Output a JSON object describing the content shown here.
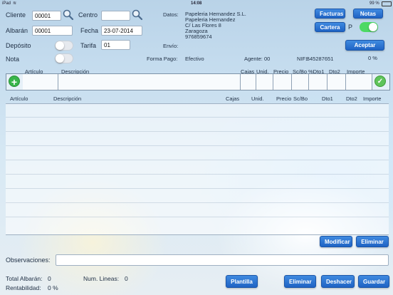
{
  "status_bar": {
    "device": "iPad",
    "time": "14:08",
    "battery": "99 %"
  },
  "header": {
    "cliente_label": "Cliente",
    "cliente_value": "00001",
    "centro_label": "Centro",
    "centro_value": "",
    "albaran_label": "Albarán",
    "albaran_value": "00001",
    "fecha_label": "Fecha",
    "fecha_value": "23-07-2014",
    "deposito_label": "Depósito",
    "tarifa_label": "Tarifa",
    "tarifa_value": "01",
    "nota_label": "Nota",
    "datos_label": "Datos:",
    "datos_lines": [
      "Papeleria Hernandez S.L.",
      "Papeleria Hernandez",
      "C/ Las Flores 8",
      "Zaragoza",
      "976859674"
    ],
    "envio_label": "Envío:",
    "forma_pago_label": "Forma Pago:",
    "forma_pago_value": "Efectivo",
    "agente_label": "Agente:",
    "agente_value": "00",
    "nif_label": "NIF:",
    "nif_value": "B45287651",
    "percent_value": "0 %",
    "facturas_button": "Facturas",
    "notas_button": "Notas",
    "cartera_button": "Cartera",
    "p_label": "P",
    "aceptar_button": "Aceptar"
  },
  "entry_columns": [
    "Artículo",
    "Descripción",
    "Cajas",
    "Unid.",
    "Precio",
    "Sc/Bo",
    "%Dto1",
    "Dto2",
    "Importe"
  ],
  "table_columns": [
    "Artículo",
    "Descripción",
    "Cajas",
    "Unid.",
    "Precio",
    "Sc/Bo",
    "Dto1",
    "Dto2",
    "Importe"
  ],
  "table_rows": [],
  "actions": {
    "modificar": "Modificar",
    "eliminar": "Eliminar"
  },
  "observaciones_label": "Observaciones:",
  "observaciones_value": "",
  "footer": {
    "total_albaran_label": "Total Albarán:",
    "total_albaran_value": "0",
    "num_lineas_label": "Num. Lineas:",
    "num_lineas_value": "0",
    "rentabilidad_label": "Rentabilidad:",
    "rentabilidad_value": "0 %",
    "plantilla_button": "Plantilla",
    "eliminar_button": "Eliminar",
    "deshacer_button": "Deshacer",
    "guardar_button": "Guardar"
  },
  "icons": {
    "search": "search-icon",
    "add": "add-line-icon",
    "confirm": "confirm-line-icon"
  },
  "colors": {
    "accent": "#2a72d6",
    "toggle_on": "#4cd964",
    "add": "#39b54a"
  }
}
